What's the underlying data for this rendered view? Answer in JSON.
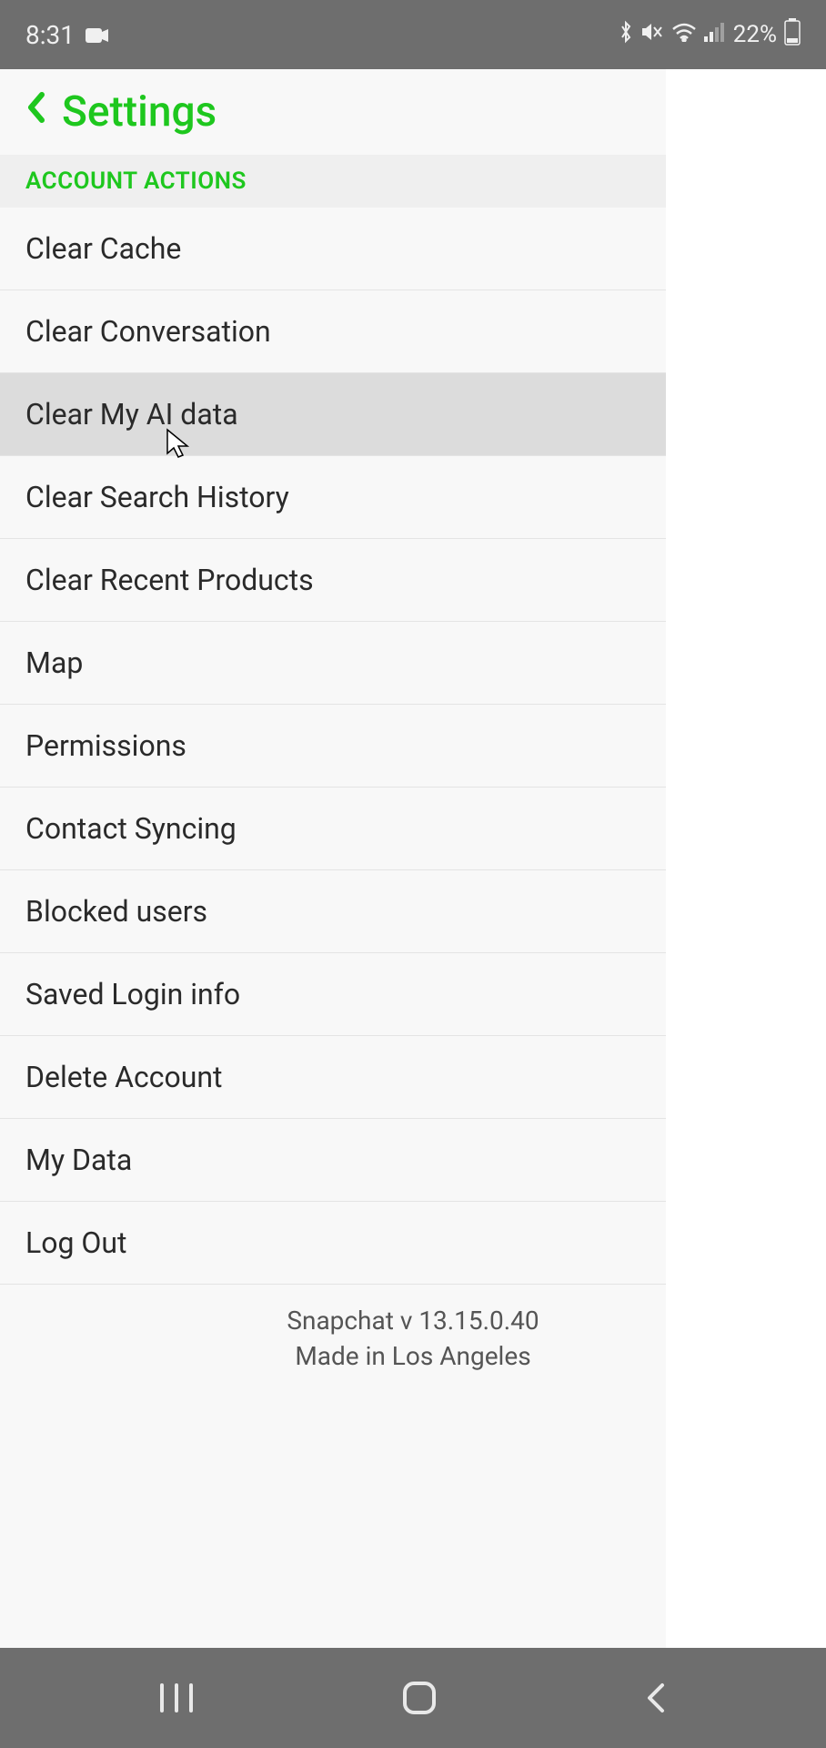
{
  "status_bar": {
    "time": "8:31",
    "battery_percent": "22%"
  },
  "header": {
    "title": "Settings"
  },
  "section": {
    "label": "ACCOUNT ACTIONS"
  },
  "items": [
    {
      "label": "Clear Cache",
      "pressed": false
    },
    {
      "label": "Clear Conversation",
      "pressed": false
    },
    {
      "label": "Clear My AI data",
      "pressed": true
    },
    {
      "label": "Clear Search History",
      "pressed": false
    },
    {
      "label": "Clear Recent Products",
      "pressed": false
    },
    {
      "label": "Map",
      "pressed": false
    },
    {
      "label": "Permissions",
      "pressed": false
    },
    {
      "label": "Contact Syncing",
      "pressed": false
    },
    {
      "label": "Blocked users",
      "pressed": false
    },
    {
      "label": "Saved Login info",
      "pressed": false
    },
    {
      "label": "Delete Account",
      "pressed": false
    },
    {
      "label": "My Data",
      "pressed": false
    },
    {
      "label": "Log Out",
      "pressed": false
    }
  ],
  "footer": {
    "version": "Snapchat v 13.15.0.40",
    "made_in": "Made in Los Angeles"
  }
}
